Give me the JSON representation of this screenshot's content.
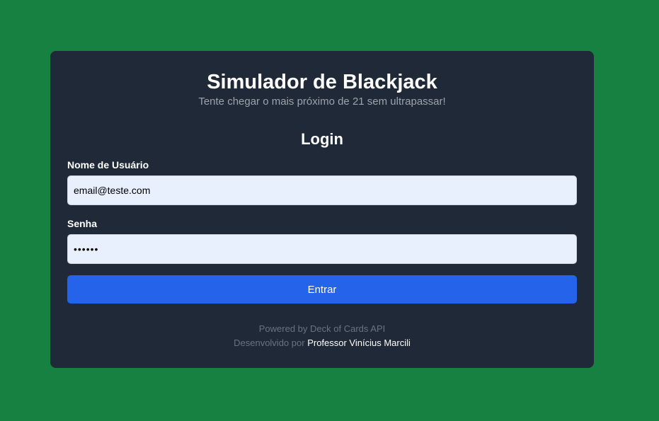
{
  "page": {
    "title": "Simulador de Blackjack",
    "subtitle": "Tente chegar o mais próximo de 21 sem ultrapassar!"
  },
  "login": {
    "heading": "Login",
    "username_label": "Nome de Usuário",
    "username_value": "email@teste.com",
    "password_label": "Senha",
    "password_value": "123456",
    "submit_label": "Entrar"
  },
  "footer": {
    "powered_by": "Powered by Deck of Cards API",
    "developed_by_prefix": "Desenvolvido por",
    "author": "Professor Vinícius Marcili"
  },
  "colors": {
    "background": "#168140",
    "card": "#1f2937",
    "input_background": "#e8f0fe",
    "button": "#2563eb",
    "muted_text": "#9ca3af"
  }
}
